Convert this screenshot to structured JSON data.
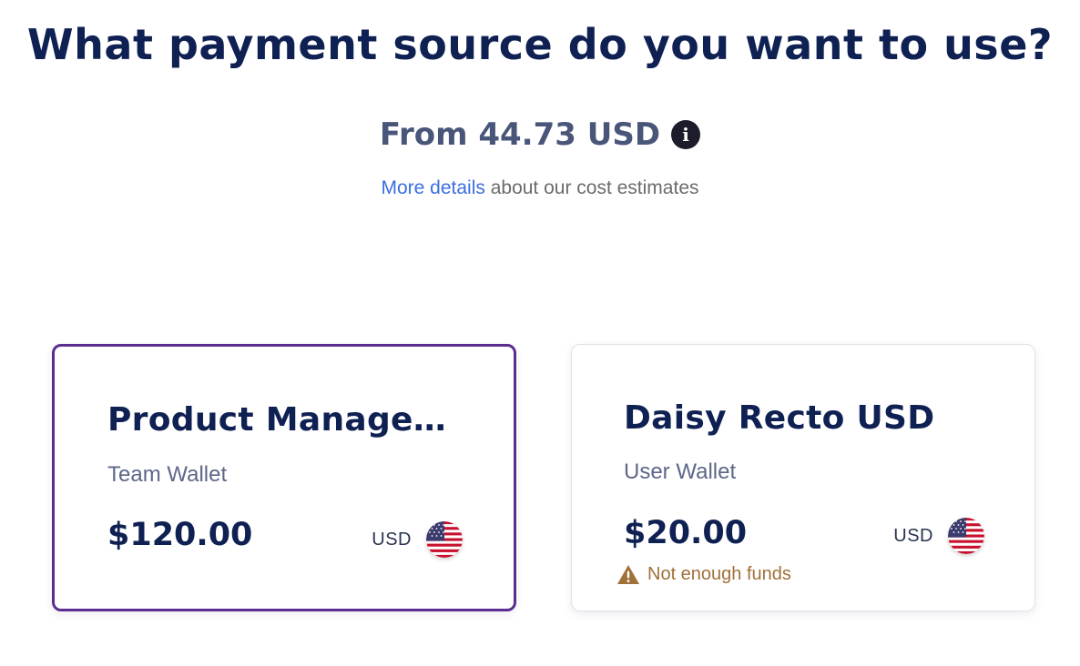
{
  "header": {
    "title": "What payment source do you want to use?",
    "price": "From 44.73 USD",
    "details_link": "More details",
    "details_suffix": " about our cost estimates"
  },
  "colors": {
    "selected_border": "#5c2d91",
    "title": "#0f2153",
    "link": "#3b6fe0",
    "warning": "#a0713a"
  },
  "wallets": [
    {
      "name": "Product Management",
      "type": "Team Wallet",
      "balance": "$120.00",
      "currency": "USD",
      "flag_icon": "us-flag-icon",
      "selected": true,
      "warning": ""
    },
    {
      "name": "Daisy Recto USD",
      "type": "User Wallet",
      "balance": "$20.00",
      "currency": "USD",
      "flag_icon": "us-flag-icon",
      "selected": false,
      "warning": "Not enough funds"
    }
  ]
}
